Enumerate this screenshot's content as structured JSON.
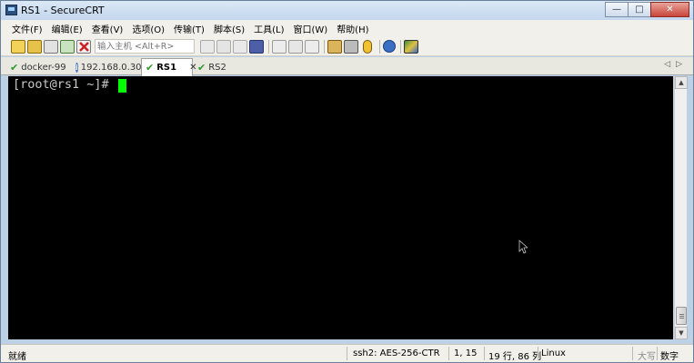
{
  "window": {
    "title": "RS1 - SecureCRT",
    "minimize_glyph": "—",
    "maximize_glyph": "□",
    "close_glyph": "✕"
  },
  "menu": [
    {
      "label": "文件(F)"
    },
    {
      "label": "编辑(E)"
    },
    {
      "label": "查看(V)"
    },
    {
      "label": "选项(O)"
    },
    {
      "label": "传输(T)"
    },
    {
      "label": "脚本(S)"
    },
    {
      "label": "工具(L)"
    },
    {
      "label": "窗口(W)"
    },
    {
      "label": "帮助(H)"
    }
  ],
  "toolbar": {
    "host_placeholder": "输入主机 <Alt+R>"
  },
  "tabs": [
    {
      "label": "docker-99",
      "icon": "check-icon",
      "active": false
    },
    {
      "label": "192.168.0.30",
      "icon": "info-icon",
      "active": false
    },
    {
      "label": "RS1",
      "icon": "check-icon",
      "active": true,
      "close_glyph": "✕"
    },
    {
      "label": "RS2",
      "icon": "check-icon",
      "active": false
    }
  ],
  "tab_nav": {
    "left": "◁",
    "right": "▷"
  },
  "terminal": {
    "prompt": "[root@rs1 ~]# ",
    "cursor_color": "#00ff00",
    "background": "#000000"
  },
  "scrollbar": {
    "up_glyph": "▲",
    "down_glyph": "▼"
  },
  "status": {
    "ready": "就绪",
    "encryption": "ssh2: AES-256-CTR",
    "cursor_pos": "1,  15",
    "size": "19 行, 86 列",
    "os": "Linux",
    "caps": "大写",
    "num": "数字"
  }
}
